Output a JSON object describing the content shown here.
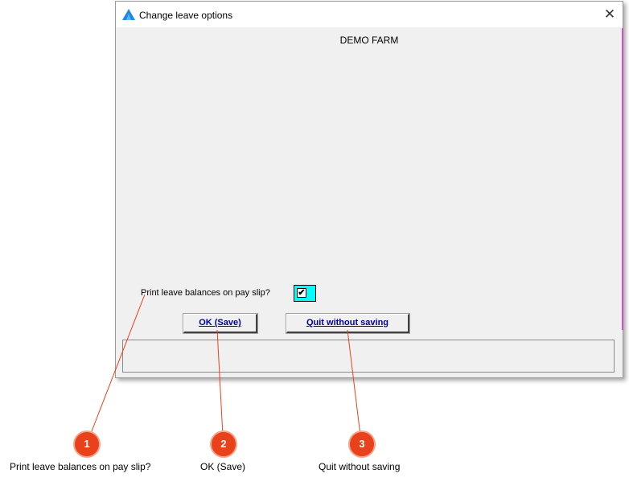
{
  "window": {
    "title": "Change leave options",
    "close_symbol": "✕",
    "icon": "app-logo-icon"
  },
  "content": {
    "farm_name": "DEMO FARM",
    "option_label": "Print leave balances on pay slip?",
    "option_checked": true,
    "check_mark": "✔"
  },
  "buttons": {
    "ok_label": "OK (Save)",
    "quit_label": "Quit without saving"
  },
  "callouts": [
    {
      "number": "1",
      "caption": "Print leave balances on pay slip?"
    },
    {
      "number": "2",
      "caption": "OK (Save)"
    },
    {
      "number": "3",
      "caption": "Quit without saving"
    }
  ],
  "colors": {
    "checkbox_bg": "#00ffff",
    "button_text": "#0000a0",
    "badge": "#e8411c",
    "edge_strip": "#d050d0"
  }
}
